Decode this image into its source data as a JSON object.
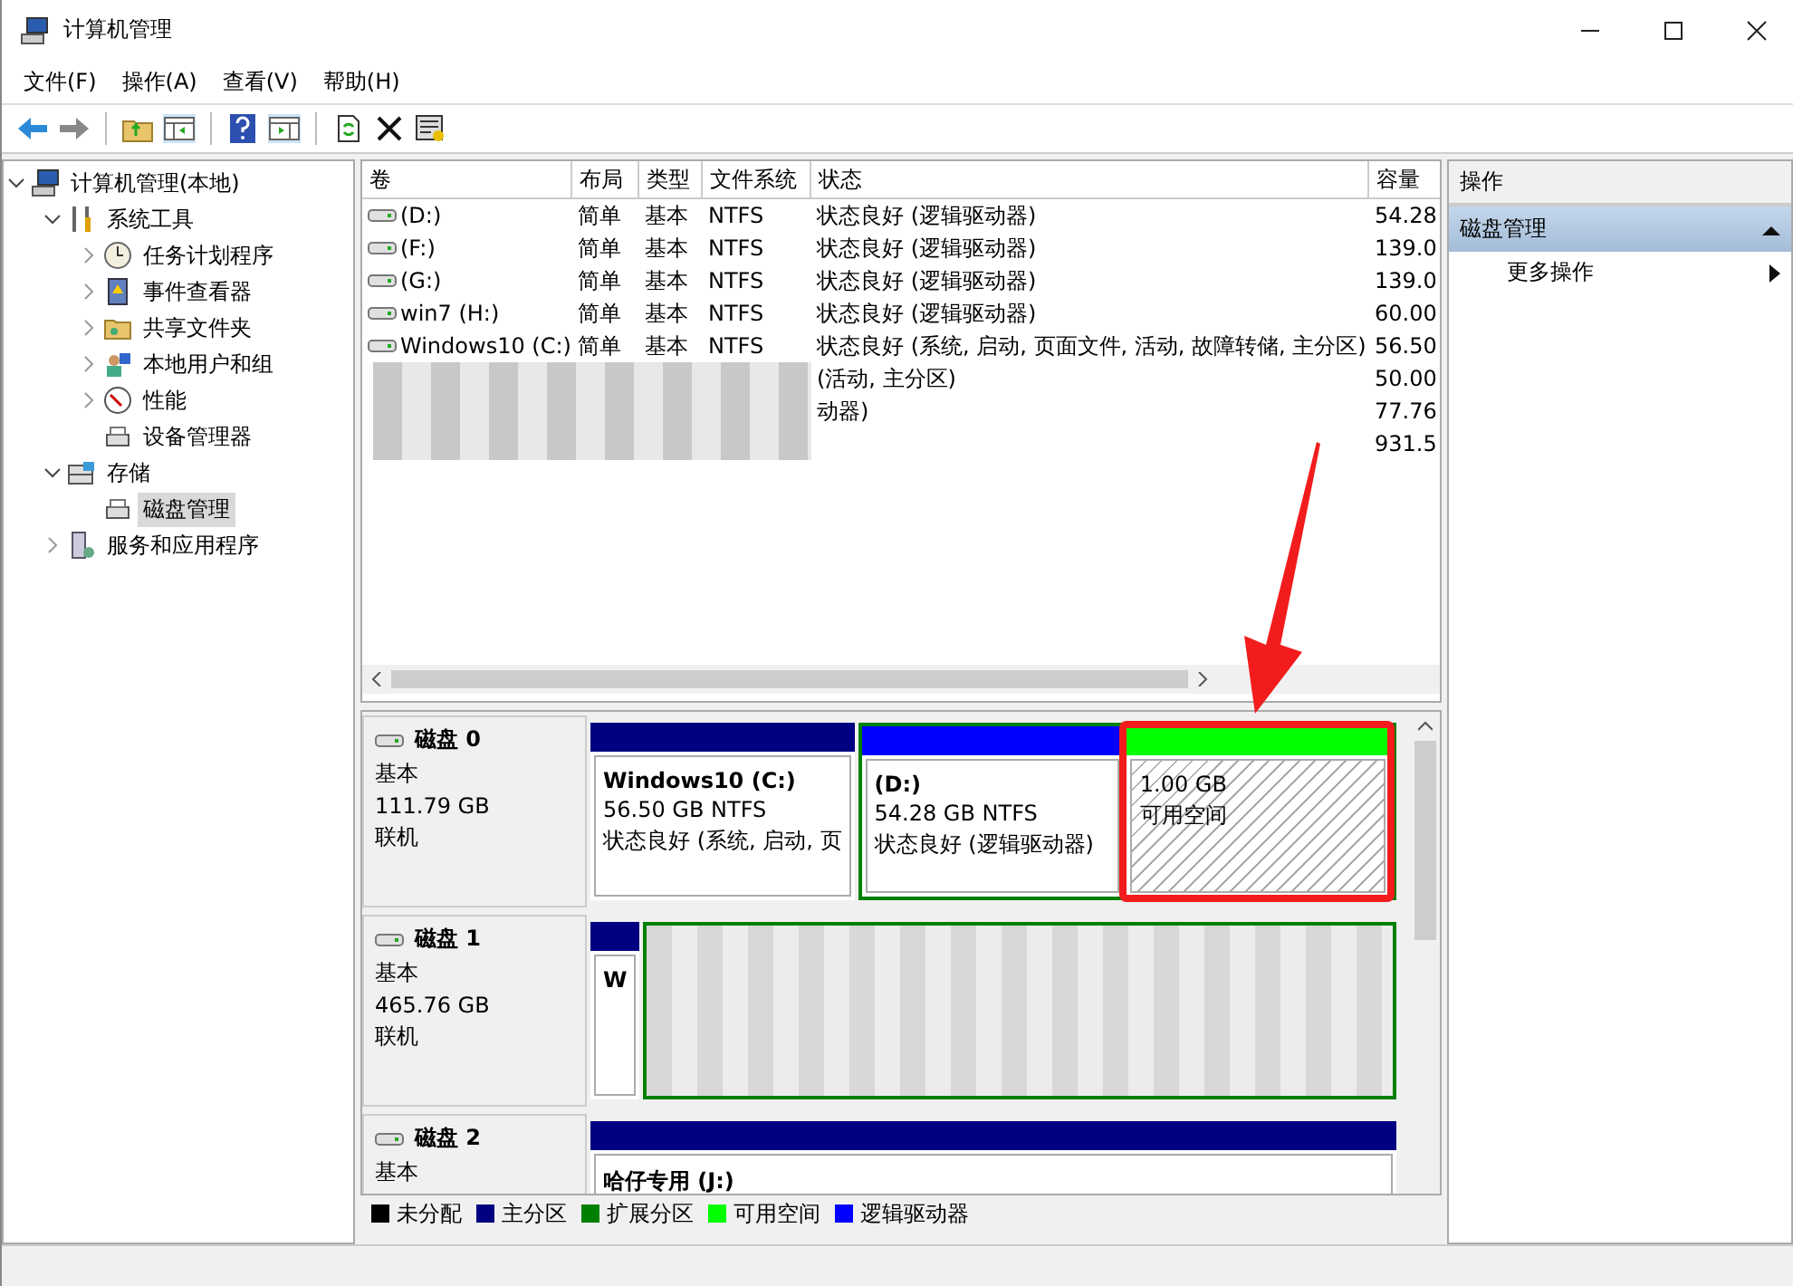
{
  "window": {
    "title": "计算机管理"
  },
  "menu": [
    "文件(F)",
    "操作(A)",
    "查看(V)",
    "帮助(H)"
  ],
  "tree": [
    {
      "label": "计算机管理(本地)",
      "expanded": true,
      "selected": false,
      "children": [
        {
          "label": "系统工具",
          "expanded": true,
          "selected": false,
          "children": [
            {
              "label": "任务计划程序",
              "expanded": false,
              "selected": false
            },
            {
              "label": "事件查看器",
              "expanded": false,
              "selected": false
            },
            {
              "label": "共享文件夹",
              "expanded": false,
              "selected": false
            },
            {
              "label": "本地用户和组",
              "expanded": false,
              "selected": false
            },
            {
              "label": "性能",
              "expanded": false,
              "selected": false
            },
            {
              "label": "设备管理器",
              "selected": false
            }
          ]
        },
        {
          "label": "存储",
          "expanded": true,
          "selected": false,
          "children": [
            {
              "label": "磁盘管理",
              "selected": true
            }
          ]
        },
        {
          "label": "服务和应用程序",
          "expanded": false,
          "selected": false
        }
      ]
    }
  ],
  "table": {
    "columns": [
      "卷",
      "布局",
      "类型",
      "文件系统",
      "状态",
      "容量"
    ],
    "rows": [
      {
        "kind": "volume",
        "cells": [
          " (D:)",
          "简单",
          "基本",
          "NTFS",
          "状态良好 (逻辑驱动器)",
          "54.28"
        ]
      },
      {
        "kind": "volume",
        "cells": [
          " (F:)",
          "简单",
          "基本",
          "NTFS",
          "状态良好 (逻辑驱动器)",
          "139.0"
        ]
      },
      {
        "kind": "volume",
        "cells": [
          " (G:)",
          "简单",
          "基本",
          "NTFS",
          "状态良好 (逻辑驱动器)",
          "139.0"
        ]
      },
      {
        "kind": "volume",
        "cells": [
          "win7 (H:)",
          "简单",
          "基本",
          "NTFS",
          "状态良好 (逻辑驱动器)",
          "60.00"
        ]
      },
      {
        "kind": "volume",
        "cells": [
          "Windows10 (C:)",
          "简单",
          "基本",
          "NTFS",
          "状态良好 (系统, 启动, 页面文件, 活动, 故障转储, 主分区)",
          "56.50"
        ]
      },
      {
        "kind": "blurred",
        "status": "(活动, 主分区)",
        "capacity": "50.00"
      },
      {
        "kind": "blurred",
        "status": "动器)",
        "capacity": "77.76"
      },
      {
        "kind": "blurred",
        "capacity": "931.5"
      }
    ]
  },
  "disks": [
    {
      "name": "磁盘 0",
      "type": "基本",
      "size": "111.79 GB",
      "status": "联机",
      "partitions": [
        {
          "kind": "primary",
          "label": "Windows10  (C:)",
          "size": "56.50 GB NTFS",
          "status": "状态良好 (系统, 启动, 页",
          "highlighted": false
        },
        {
          "kind": "extended",
          "children": [
            {
              "kind": "logical",
              "label": "(D:)",
              "size": "54.28 GB NTFS",
              "status": "状态良好 (逻辑驱动器)",
              "highlighted": false
            },
            {
              "kind": "free",
              "size": "1.00 GB",
              "status": "可用空间",
              "highlighted": true
            }
          ]
        }
      ]
    },
    {
      "name": "磁盘 1",
      "type": "基本",
      "size": "465.76 GB",
      "status": "联机",
      "partitions": [
        {
          "kind": "primary",
          "label": "W",
          "highlighted": false
        },
        {
          "kind": "blurred"
        }
      ]
    },
    {
      "name": "磁盘 2",
      "type": "基本",
      "partitions": [
        {
          "kind": "primary",
          "label": "哈仔专用  (J:)",
          "highlighted": false
        }
      ]
    }
  ],
  "legend": [
    {
      "label": "未分配",
      "color": "#000000"
    },
    {
      "label": "主分区",
      "color": "#000080"
    },
    {
      "label": "扩展分区",
      "color": "#008000"
    },
    {
      "label": "可用空间",
      "color": "#00ff00"
    },
    {
      "label": "逻辑驱动器",
      "color": "#0000ff"
    }
  ],
  "actions": {
    "title": "操作",
    "section": "磁盘管理",
    "expanded": true,
    "items": [
      "更多操作"
    ]
  },
  "annotation": {
    "kind": "arrow"
  }
}
